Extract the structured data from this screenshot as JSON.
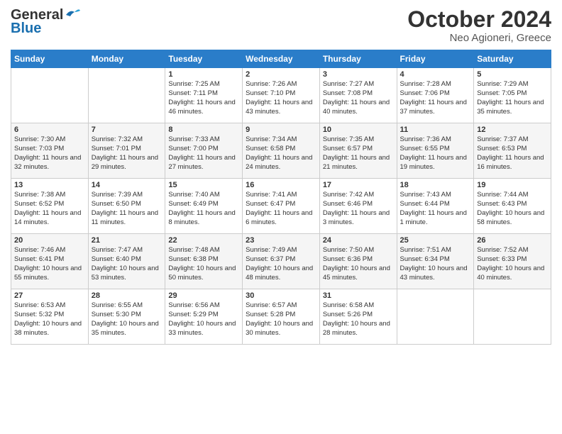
{
  "header": {
    "logo_line1": "General",
    "logo_line2": "Blue",
    "title": "October 2024",
    "location": "Neo Agioneri, Greece"
  },
  "weekdays": [
    "Sunday",
    "Monday",
    "Tuesday",
    "Wednesday",
    "Thursday",
    "Friday",
    "Saturday"
  ],
  "weeks": [
    [
      {
        "day": "",
        "info": ""
      },
      {
        "day": "",
        "info": ""
      },
      {
        "day": "1",
        "sunrise": "7:25 AM",
        "sunset": "7:11 PM",
        "daylight": "11 hours and 46 minutes."
      },
      {
        "day": "2",
        "sunrise": "7:26 AM",
        "sunset": "7:10 PM",
        "daylight": "11 hours and 43 minutes."
      },
      {
        "day": "3",
        "sunrise": "7:27 AM",
        "sunset": "7:08 PM",
        "daylight": "11 hours and 40 minutes."
      },
      {
        "day": "4",
        "sunrise": "7:28 AM",
        "sunset": "7:06 PM",
        "daylight": "11 hours and 37 minutes."
      },
      {
        "day": "5",
        "sunrise": "7:29 AM",
        "sunset": "7:05 PM",
        "daylight": "11 hours and 35 minutes."
      }
    ],
    [
      {
        "day": "6",
        "sunrise": "7:30 AM",
        "sunset": "7:03 PM",
        "daylight": "11 hours and 32 minutes."
      },
      {
        "day": "7",
        "sunrise": "7:32 AM",
        "sunset": "7:01 PM",
        "daylight": "11 hours and 29 minutes."
      },
      {
        "day": "8",
        "sunrise": "7:33 AM",
        "sunset": "7:00 PM",
        "daylight": "11 hours and 27 minutes."
      },
      {
        "day": "9",
        "sunrise": "7:34 AM",
        "sunset": "6:58 PM",
        "daylight": "11 hours and 24 minutes."
      },
      {
        "day": "10",
        "sunrise": "7:35 AM",
        "sunset": "6:57 PM",
        "daylight": "11 hours and 21 minutes."
      },
      {
        "day": "11",
        "sunrise": "7:36 AM",
        "sunset": "6:55 PM",
        "daylight": "11 hours and 19 minutes."
      },
      {
        "day": "12",
        "sunrise": "7:37 AM",
        "sunset": "6:53 PM",
        "daylight": "11 hours and 16 minutes."
      }
    ],
    [
      {
        "day": "13",
        "sunrise": "7:38 AM",
        "sunset": "6:52 PM",
        "daylight": "11 hours and 14 minutes."
      },
      {
        "day": "14",
        "sunrise": "7:39 AM",
        "sunset": "6:50 PM",
        "daylight": "11 hours and 11 minutes."
      },
      {
        "day": "15",
        "sunrise": "7:40 AM",
        "sunset": "6:49 PM",
        "daylight": "11 hours and 8 minutes."
      },
      {
        "day": "16",
        "sunrise": "7:41 AM",
        "sunset": "6:47 PM",
        "daylight": "11 hours and 6 minutes."
      },
      {
        "day": "17",
        "sunrise": "7:42 AM",
        "sunset": "6:46 PM",
        "daylight": "11 hours and 3 minutes."
      },
      {
        "day": "18",
        "sunrise": "7:43 AM",
        "sunset": "6:44 PM",
        "daylight": "11 hours and 1 minute."
      },
      {
        "day": "19",
        "sunrise": "7:44 AM",
        "sunset": "6:43 PM",
        "daylight": "10 hours and 58 minutes."
      }
    ],
    [
      {
        "day": "20",
        "sunrise": "7:46 AM",
        "sunset": "6:41 PM",
        "daylight": "10 hours and 55 minutes."
      },
      {
        "day": "21",
        "sunrise": "7:47 AM",
        "sunset": "6:40 PM",
        "daylight": "10 hours and 53 minutes."
      },
      {
        "day": "22",
        "sunrise": "7:48 AM",
        "sunset": "6:38 PM",
        "daylight": "10 hours and 50 minutes."
      },
      {
        "day": "23",
        "sunrise": "7:49 AM",
        "sunset": "6:37 PM",
        "daylight": "10 hours and 48 minutes."
      },
      {
        "day": "24",
        "sunrise": "7:50 AM",
        "sunset": "6:36 PM",
        "daylight": "10 hours and 45 minutes."
      },
      {
        "day": "25",
        "sunrise": "7:51 AM",
        "sunset": "6:34 PM",
        "daylight": "10 hours and 43 minutes."
      },
      {
        "day": "26",
        "sunrise": "7:52 AM",
        "sunset": "6:33 PM",
        "daylight": "10 hours and 40 minutes."
      }
    ],
    [
      {
        "day": "27",
        "sunrise": "6:53 AM",
        "sunset": "5:32 PM",
        "daylight": "10 hours and 38 minutes."
      },
      {
        "day": "28",
        "sunrise": "6:55 AM",
        "sunset": "5:30 PM",
        "daylight": "10 hours and 35 minutes."
      },
      {
        "day": "29",
        "sunrise": "6:56 AM",
        "sunset": "5:29 PM",
        "daylight": "10 hours and 33 minutes."
      },
      {
        "day": "30",
        "sunrise": "6:57 AM",
        "sunset": "5:28 PM",
        "daylight": "10 hours and 30 minutes."
      },
      {
        "day": "31",
        "sunrise": "6:58 AM",
        "sunset": "5:26 PM",
        "daylight": "10 hours and 28 minutes."
      },
      {
        "day": "",
        "info": ""
      },
      {
        "day": "",
        "info": ""
      }
    ]
  ]
}
